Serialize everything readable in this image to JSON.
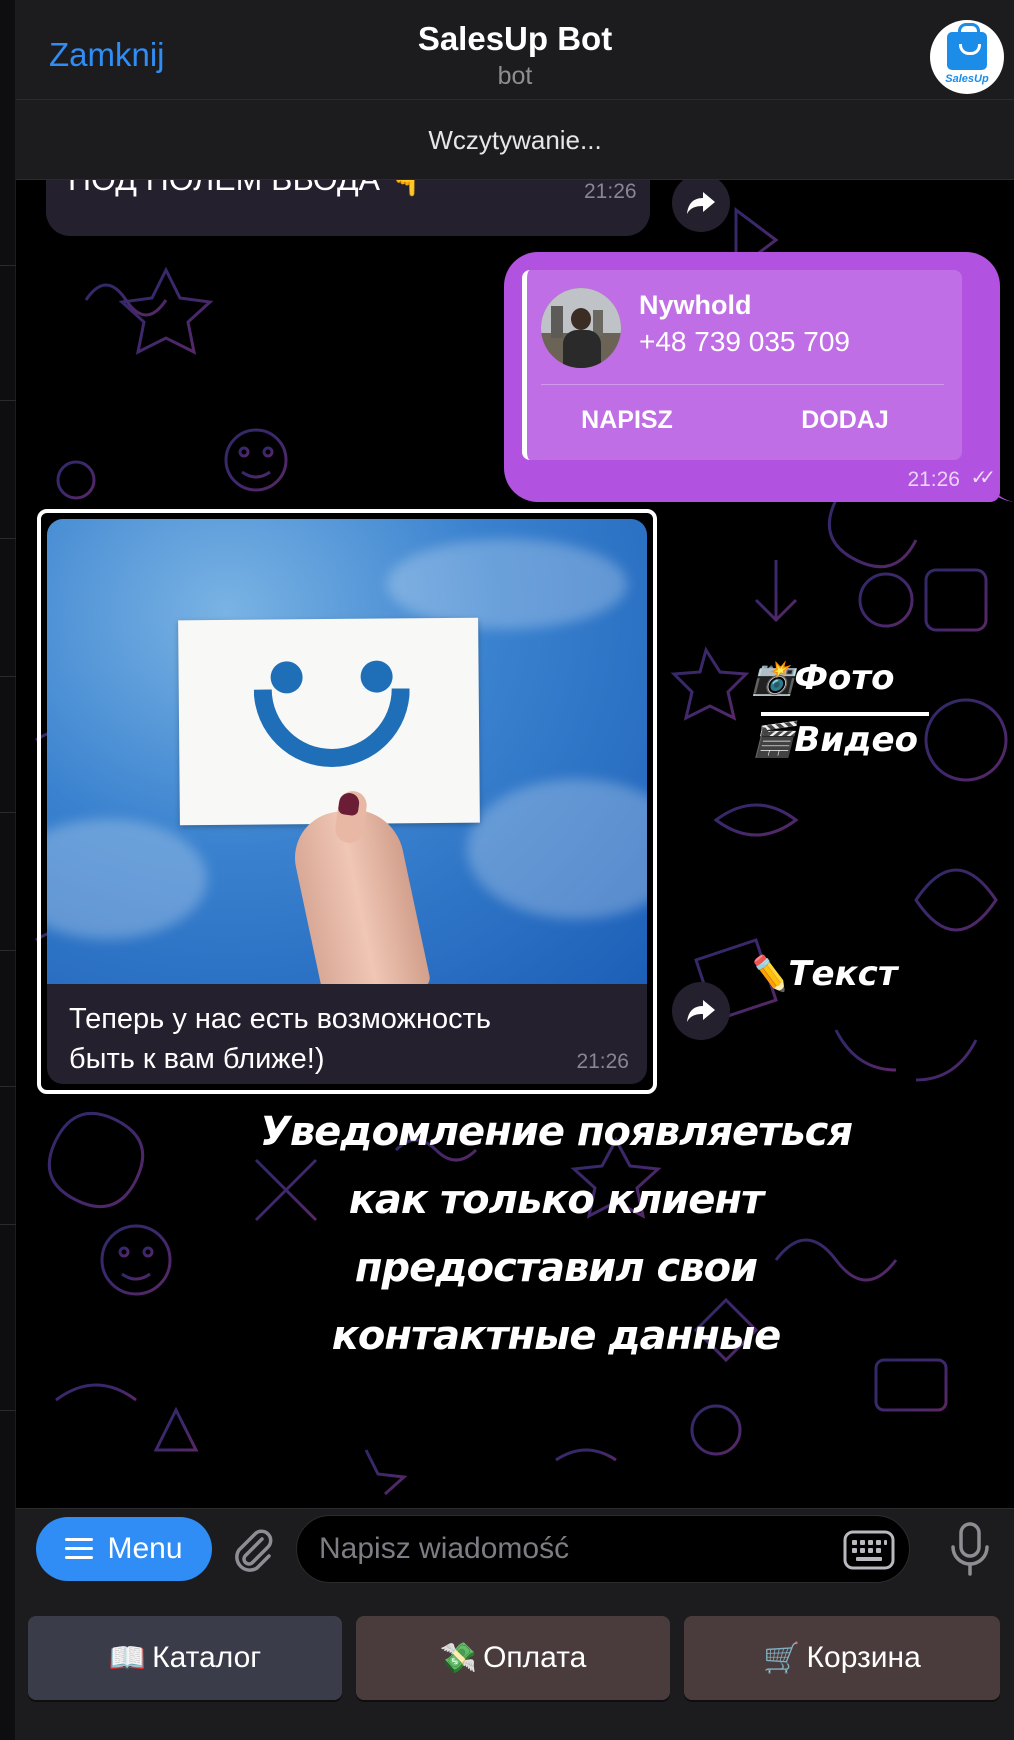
{
  "header": {
    "close_label": "Zamknij",
    "title": "SalesUp Bot",
    "subtitle": "bot",
    "logo_text": "SalesUp"
  },
  "status": {
    "loading_text": "Wczytywanie..."
  },
  "messages": {
    "top_message": {
      "text": "ПОД ПОЛЕМ ВВОДА 👇",
      "time": "21:26"
    },
    "contact": {
      "name": "Nywhold",
      "phone": "+48 739 035 709",
      "write_label": "NAPISZ",
      "add_label": "DODAJ",
      "time": "21:26"
    },
    "photo_message": {
      "caption_line1": "Теперь у нас есть возможность",
      "caption_line2": "быть к вам ближе!)",
      "time": "21:26"
    }
  },
  "annotations": {
    "photo": "📸Фото",
    "video": "🎬Видео",
    "text": "✏️Текст",
    "notice_line1": "Уведомление появляеться",
    "notice_line2": "как только клиент",
    "notice_line3": "предоставил свои",
    "notice_line4": "контактные данные"
  },
  "composer": {
    "menu_label": "Menu",
    "input_placeholder": "Napisz wiadomość"
  },
  "keyboard": {
    "buttons": [
      {
        "emoji": "📖",
        "label": "Каталог",
        "color": "#3a3c4a"
      },
      {
        "emoji": "💸",
        "label": "Оплата",
        "color": "#4a3c3c"
      },
      {
        "emoji": "🛒",
        "label": "Корзина",
        "color": "#4a3c3c"
      }
    ]
  },
  "colors": {
    "accent": "#2f8df5",
    "outgoing_bubble": "#b152e0",
    "incoming_bubble": "#24202e",
    "header_bg": "#1c1c1e"
  }
}
